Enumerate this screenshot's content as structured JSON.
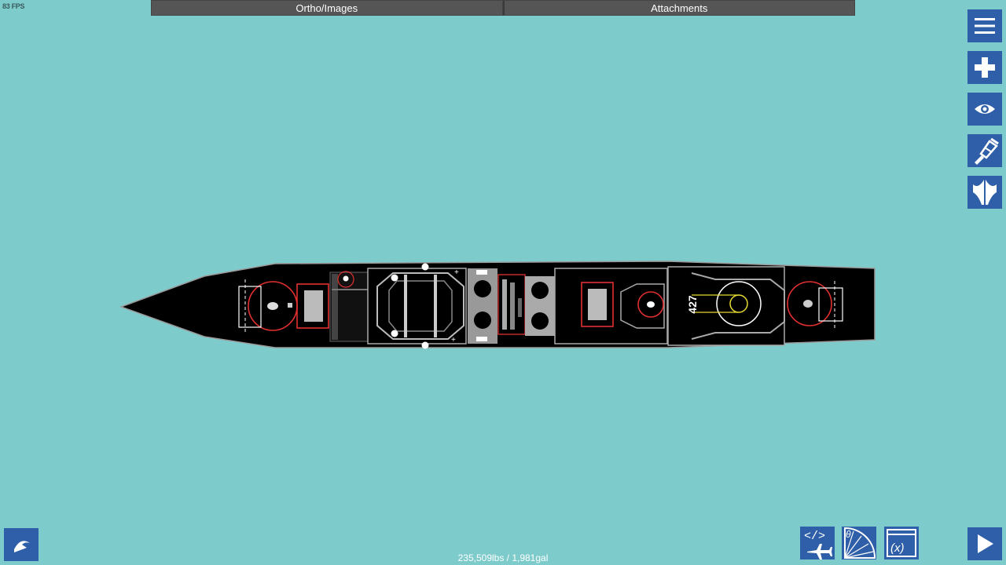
{
  "fps": "83 FPS",
  "tabs": [
    {
      "label": "Ortho/Images"
    },
    {
      "label": "Attachments"
    }
  ],
  "side_menu": [
    {
      "icon": "menu-icon"
    },
    {
      "icon": "add-part-icon"
    },
    {
      "icon": "view-icon"
    },
    {
      "icon": "paint-icon"
    },
    {
      "icon": "symmetry-icon"
    }
  ],
  "bottom_tools": [
    {
      "icon": "undo-icon"
    },
    {
      "icon": "code-aircraft-icon"
    },
    {
      "icon": "angle-gauge-icon"
    },
    {
      "icon": "variables-icon"
    },
    {
      "icon": "play-icon"
    }
  ],
  "ship": {
    "hull_number": "427"
  },
  "status": {
    "text": "235,509lbs / 1,981gal"
  },
  "colors": {
    "background": "#7ecbcc",
    "button": "#2f5fa8",
    "tab": "#555555",
    "hull": "#000000"
  }
}
